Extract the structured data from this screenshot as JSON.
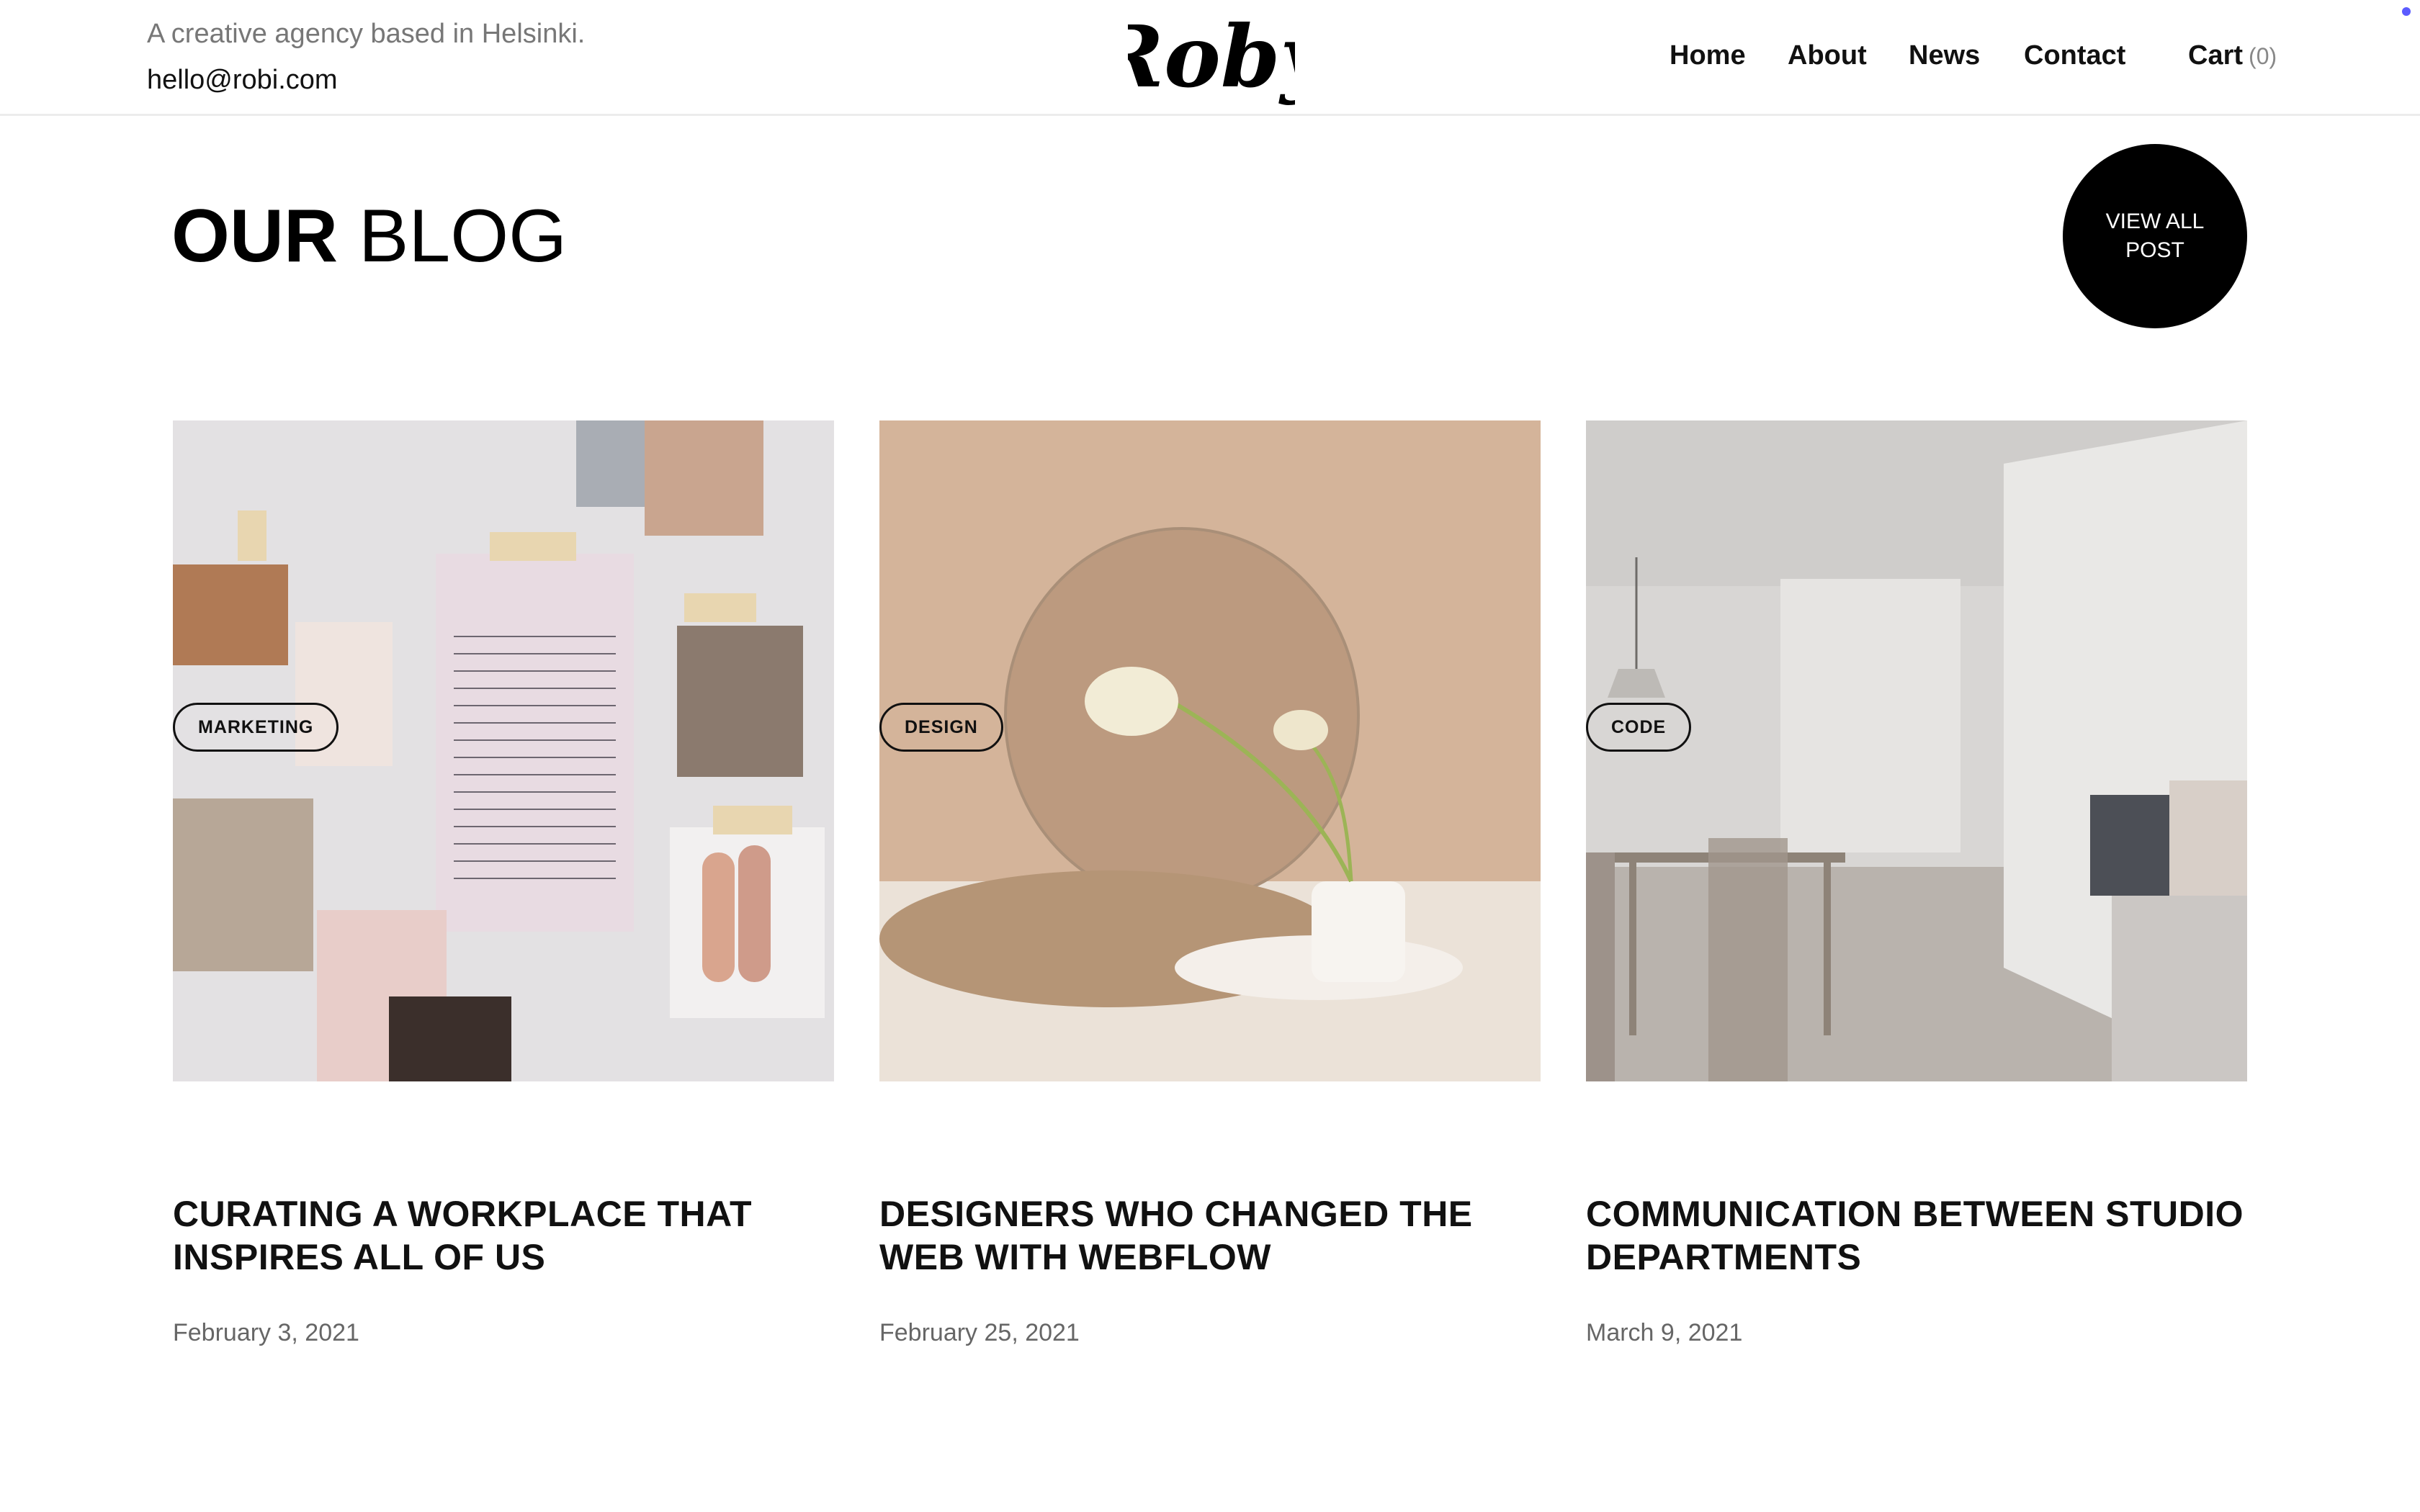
{
  "header": {
    "tagline": "A creative agency based in Helsinki.",
    "email": "hello@robi.com",
    "logo_text": "Roby",
    "nav": [
      {
        "label": "Home"
      },
      {
        "label": "About"
      },
      {
        "label": "News"
      },
      {
        "label": "Contact"
      }
    ],
    "cart": {
      "label": "Cart",
      "count": "(0)"
    }
  },
  "blog": {
    "title_strong": "OUR",
    "title_light": "BLOG",
    "view_all_label": "VIEW ALL POST",
    "posts": [
      {
        "tag": "MARKETING",
        "title": "CURATING A WORKPLACE THAT INSPIRES ALL OF US",
        "date": "February 3, 2021",
        "image": "moodboard-image"
      },
      {
        "tag": "DESIGN",
        "title": "DESIGNERS WHO CHANGED THE WEB WITH WEBFLOW",
        "date": "February 25, 2021",
        "image": "mirror-flower-image"
      },
      {
        "tag": "CODE",
        "title": "COMMUNICATION BETWEEN STUDIO DEPARTMENTS",
        "date": "March 9, 2021",
        "image": "interior-dining-image"
      }
    ]
  },
  "colors": {
    "accent": "#000000",
    "muted": "#777777",
    "border": "#ececec"
  }
}
